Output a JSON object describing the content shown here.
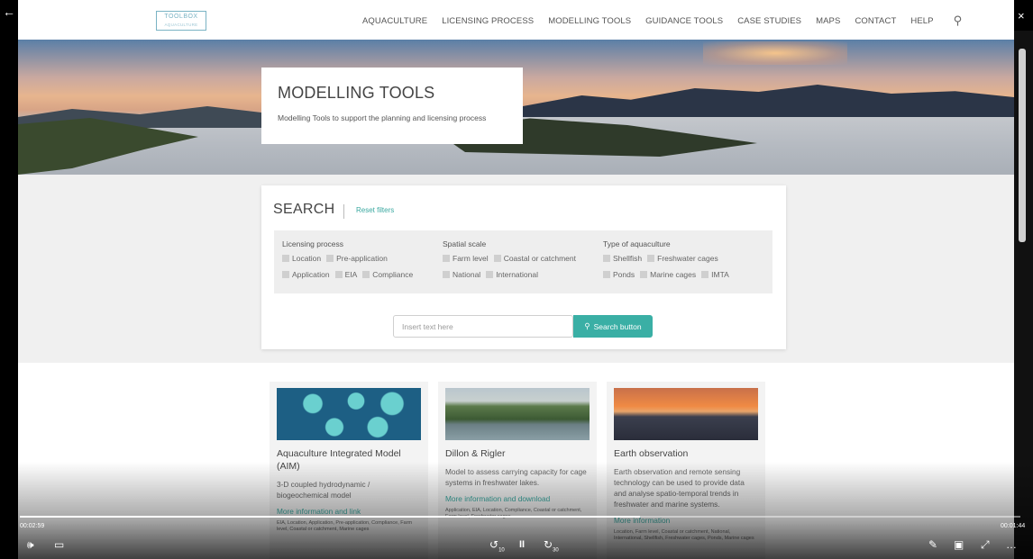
{
  "window": {
    "back_icon": "←",
    "minimize_icon": "–",
    "maximize_icon": "▫",
    "close_icon": "×"
  },
  "logo": {
    "line1": "TOOLBOX",
    "line2": "AQUACULTURE"
  },
  "nav": {
    "items": [
      "AQUACULTURE",
      "LICENSING PROCESS",
      "MODELLING TOOLS",
      "GUIDANCE TOOLS",
      "CASE STUDIES",
      "MAPS",
      "CONTACT",
      "HELP"
    ],
    "search_icon": "⚲"
  },
  "hero": {
    "title": "MODELLING TOOLS",
    "subtitle": "Modelling Tools to support the planning and licensing process"
  },
  "search": {
    "title": "SEARCH",
    "reset_label": "Reset filters",
    "groups": {
      "licensing": {
        "label": "Licensing process",
        "options": [
          "Location",
          "Pre-application",
          "Application",
          "EIA",
          "Compliance"
        ]
      },
      "spatial": {
        "label": "Spatial scale",
        "options": [
          "Farm level",
          "Coastal or catchment",
          "National",
          "International"
        ]
      },
      "type": {
        "label": "Type of aquaculture",
        "options": [
          "Shellfish",
          "Freshwater cages",
          "Ponds",
          "Marine cages",
          "IMTA"
        ]
      }
    },
    "input_placeholder": "Insert text here",
    "button_label": "Search button",
    "button_icon": "⚲"
  },
  "cards": [
    {
      "title": "Aquaculture Integrated Model (AIM)",
      "description": "3-D coupled hydrodynamic / biogeochemical model",
      "link": "More information and link",
      "tags": "EIA, Location, Application, Pre-application, Compliance, Farm level, Coastal or catchment, Marine cages"
    },
    {
      "title": "Dillon & Rigler",
      "description": "Model to assess carrying capacity for cage systems in freshwater lakes.",
      "link": "More information and download",
      "tags": "Application, EIA, Location, Compliance, Coastal or catchment, Farm level, Freshwater cages"
    },
    {
      "title": "Earth observation",
      "description": "Earth observation and remote sensing technology can be used to provide data and analyse spatio-temporal trends in freshwater and marine systems.",
      "link": "More information",
      "tags": "Location, Farm level, Coastal or catchment, National, International, Shellfish, Freshwater cages, Ponds, Marine cages"
    }
  ],
  "video": {
    "elapsed": "00:02:59",
    "remaining": "00:01:44",
    "progress": 0.62,
    "volume_icon": "🕪",
    "captions_icon": "▭",
    "rewind_icon": "↺",
    "rewind_label": "10",
    "pause_icon": "II",
    "forward_icon": "↻",
    "forward_label": "30",
    "pen_icon": "✎",
    "miniplayer_icon": "▣",
    "fullscreen_icon": "⤢",
    "more_icon": "…"
  }
}
